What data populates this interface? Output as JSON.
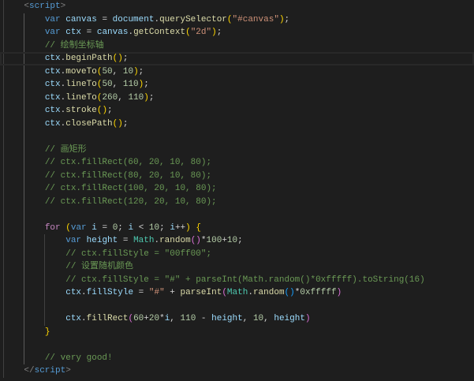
{
  "theme": {
    "background": "#1e1e1e",
    "foreground": "#d4d4d4",
    "line_highlight_border": "#282828",
    "indent_guide": "#404040",
    "active_indent_guide": "#5a5a5a",
    "syntax": {
      "kw": "#569cd6",
      "ctrl": "#c586c0",
      "var": "#9cdcfe",
      "fn": "#dcdcaa",
      "cls": "#4ec9b0",
      "str": "#ce9178",
      "num": "#b5cea8",
      "cmt": "#6a9955",
      "punct": "#d4d4d4",
      "ws": "#d4d4d4",
      "tagp": "#808080",
      "tag": "#569cd6",
      "b1": "#ffd700",
      "b2": "#da70d6",
      "b3": "#179fff"
    }
  },
  "editor": {
    "lines": [
      {
        "tokens": [
          {
            "ws": "    "
          },
          {
            "tagp": "<"
          },
          {
            "tag": "script"
          },
          {
            "tagp": ">"
          }
        ]
      },
      {
        "tokens": [
          {
            "ws": "        "
          },
          {
            "kw": "var"
          },
          {
            "ws": " "
          },
          {
            "var": "canvas"
          },
          {
            "punct": " = "
          },
          {
            "var": "document"
          },
          {
            "punct": "."
          },
          {
            "fn": "querySelector"
          },
          {
            "b1": "("
          },
          {
            "str": "\"#canvas\""
          },
          {
            "b1": ")"
          },
          {
            "punct": ";"
          }
        ]
      },
      {
        "tokens": [
          {
            "ws": "        "
          },
          {
            "kw": "var"
          },
          {
            "ws": " "
          },
          {
            "var": "ctx"
          },
          {
            "punct": " = "
          },
          {
            "var": "canvas"
          },
          {
            "punct": "."
          },
          {
            "fn": "getContext"
          },
          {
            "b1": "("
          },
          {
            "str": "\"2d\""
          },
          {
            "b1": ")"
          },
          {
            "punct": ";"
          }
        ]
      },
      {
        "tokens": [
          {
            "ws": "        "
          },
          {
            "cmt": "// 绘制坐标轴"
          }
        ]
      },
      {
        "active": true,
        "tokens": [
          {
            "ws": "        "
          },
          {
            "var": "ctx"
          },
          {
            "punct": "."
          },
          {
            "fn": "beginPath"
          },
          {
            "b1": "()"
          },
          {
            "punct": ";"
          }
        ]
      },
      {
        "tokens": [
          {
            "ws": "        "
          },
          {
            "var": "ctx"
          },
          {
            "punct": "."
          },
          {
            "fn": "moveTo"
          },
          {
            "b1": "("
          },
          {
            "num": "50"
          },
          {
            "punct": ", "
          },
          {
            "num": "10"
          },
          {
            "b1": ")"
          },
          {
            "punct": ";"
          }
        ]
      },
      {
        "tokens": [
          {
            "ws": "        "
          },
          {
            "var": "ctx"
          },
          {
            "punct": "."
          },
          {
            "fn": "lineTo"
          },
          {
            "b1": "("
          },
          {
            "num": "50"
          },
          {
            "punct": ", "
          },
          {
            "num": "110"
          },
          {
            "b1": ")"
          },
          {
            "punct": ";"
          }
        ]
      },
      {
        "tokens": [
          {
            "ws": "        "
          },
          {
            "var": "ctx"
          },
          {
            "punct": "."
          },
          {
            "fn": "lineTo"
          },
          {
            "b1": "("
          },
          {
            "num": "260"
          },
          {
            "punct": ", "
          },
          {
            "num": "110"
          },
          {
            "b1": ")"
          },
          {
            "punct": ";"
          }
        ]
      },
      {
        "tokens": [
          {
            "ws": "        "
          },
          {
            "var": "ctx"
          },
          {
            "punct": "."
          },
          {
            "fn": "stroke"
          },
          {
            "b1": "()"
          },
          {
            "punct": ";"
          }
        ]
      },
      {
        "tokens": [
          {
            "ws": "        "
          },
          {
            "var": "ctx"
          },
          {
            "punct": "."
          },
          {
            "fn": "closePath"
          },
          {
            "b1": "()"
          },
          {
            "punct": ";"
          }
        ]
      },
      {
        "tokens": []
      },
      {
        "tokens": [
          {
            "ws": "        "
          },
          {
            "cmt": "// 画矩形"
          }
        ]
      },
      {
        "tokens": [
          {
            "ws": "        "
          },
          {
            "cmt": "// ctx.fillRect(60, 20, 10, 80);"
          }
        ]
      },
      {
        "tokens": [
          {
            "ws": "        "
          },
          {
            "cmt": "// ctx.fillRect(80, 20, 10, 80);"
          }
        ]
      },
      {
        "tokens": [
          {
            "ws": "        "
          },
          {
            "cmt": "// ctx.fillRect(100, 20, 10, 80);"
          }
        ]
      },
      {
        "tokens": [
          {
            "ws": "        "
          },
          {
            "cmt": "// ctx.fillRect(120, 20, 10, 80);"
          }
        ]
      },
      {
        "tokens": []
      },
      {
        "tokens": [
          {
            "ws": "        "
          },
          {
            "ctrl": "for"
          },
          {
            "ws": " "
          },
          {
            "b1": "("
          },
          {
            "kw": "var"
          },
          {
            "ws": " "
          },
          {
            "var": "i"
          },
          {
            "punct": " = "
          },
          {
            "num": "0"
          },
          {
            "punct": "; "
          },
          {
            "var": "i"
          },
          {
            "punct": " < "
          },
          {
            "num": "10"
          },
          {
            "punct": "; "
          },
          {
            "var": "i"
          },
          {
            "punct": "++"
          },
          {
            "b1": ")"
          },
          {
            "ws": " "
          },
          {
            "b1": "{"
          }
        ]
      },
      {
        "tokens": [
          {
            "ws": "            "
          },
          {
            "kw": "var"
          },
          {
            "ws": " "
          },
          {
            "var": "height"
          },
          {
            "punct": " = "
          },
          {
            "cls": "Math"
          },
          {
            "punct": "."
          },
          {
            "fn": "random"
          },
          {
            "b2": "()"
          },
          {
            "punct": "*"
          },
          {
            "num": "100"
          },
          {
            "punct": "+"
          },
          {
            "num": "10"
          },
          {
            "punct": ";"
          }
        ]
      },
      {
        "tokens": [
          {
            "ws": "            "
          },
          {
            "cmt": "// ctx.fillStyle = \"00ff00\";"
          }
        ]
      },
      {
        "tokens": [
          {
            "ws": "            "
          },
          {
            "cmt": "// 设置随机颜色"
          }
        ]
      },
      {
        "tokens": [
          {
            "ws": "            "
          },
          {
            "cmt": "// ctx.fillStyle = \"#\" + parseInt(Math.random()*0xfffff).toString(16)"
          }
        ]
      },
      {
        "tokens": [
          {
            "ws": "            "
          },
          {
            "var": "ctx"
          },
          {
            "punct": "."
          },
          {
            "var": "fillStyle"
          },
          {
            "punct": " = "
          },
          {
            "str": "\"#\""
          },
          {
            "punct": " + "
          },
          {
            "fn": "parseInt"
          },
          {
            "b2": "("
          },
          {
            "cls": "Math"
          },
          {
            "punct": "."
          },
          {
            "fn": "random"
          },
          {
            "b3": "()"
          },
          {
            "punct": "*"
          },
          {
            "num": "0xfffff"
          },
          {
            "b2": ")"
          }
        ]
      },
      {
        "tokens": []
      },
      {
        "tokens": [
          {
            "ws": "            "
          },
          {
            "var": "ctx"
          },
          {
            "punct": "."
          },
          {
            "fn": "fillRect"
          },
          {
            "b2": "("
          },
          {
            "num": "60"
          },
          {
            "punct": "+"
          },
          {
            "num": "20"
          },
          {
            "punct": "*"
          },
          {
            "var": "i"
          },
          {
            "punct": ", "
          },
          {
            "num": "110"
          },
          {
            "punct": " - "
          },
          {
            "var": "height"
          },
          {
            "punct": ", "
          },
          {
            "num": "10"
          },
          {
            "punct": ", "
          },
          {
            "var": "height"
          },
          {
            "b2": ")"
          }
        ]
      },
      {
        "tokens": [
          {
            "ws": "        "
          },
          {
            "b1": "}"
          }
        ]
      },
      {
        "tokens": []
      },
      {
        "tokens": [
          {
            "ws": "        "
          },
          {
            "cmt": "// very good!"
          }
        ]
      },
      {
        "tokens": [
          {
            "ws": "    "
          },
          {
            "tagp": "</"
          },
          {
            "tag": "script"
          },
          {
            "tagp": ">"
          }
        ]
      }
    ]
  }
}
